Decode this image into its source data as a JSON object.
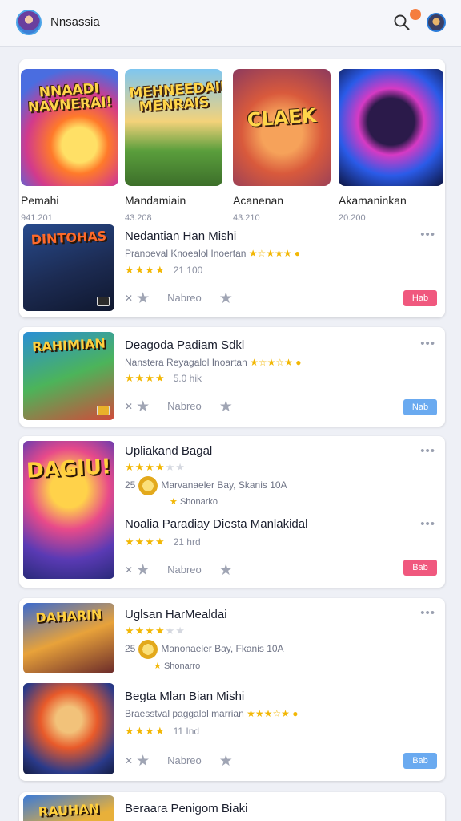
{
  "header": {
    "title": "Nnsassia"
  },
  "featured": [
    {
      "art_text": "NNAADI NAVNERAI!",
      "name": "Pemahi",
      "meta": "941.201"
    },
    {
      "art_text": "MEHNEEDAIN MENRAIS",
      "name": "Mandamiain",
      "meta": "43.208"
    },
    {
      "art_text": "CLAEK",
      "name": "Acanenan",
      "meta": "43.210"
    },
    {
      "art_text": "",
      "name": "Akamaninkan",
      "meta": "20.200"
    }
  ],
  "cards": {
    "c1": {
      "thumb_text": "DINTOHAS",
      "title": "Nedantian Han Mishi",
      "subtitle": "Pranoeval Knoealol Inoertan",
      "rating_count": "21 100",
      "action_label": "Nabreo",
      "button": "Hab"
    },
    "c2": {
      "thumb_text": "RAHIMIAN",
      "title": "Deagoda Padiam Sdkl",
      "subtitle": "Nanstera Reyagalol Inoartan",
      "rating_count": "5.0 hik",
      "action_label": "Nabreo",
      "button": "Nab"
    },
    "c3": {
      "thumb_text": "DAGIU!",
      "title": "Upliakand Bagal",
      "coin_prefix": "25",
      "coin_text": "Marvanaeler Bay, Skanis 10A",
      "coin_sub": "Shonarko",
      "title2": "Noalia Paradiay Diesta Manlakidal",
      "rating_count": "21 hrd",
      "action_label": "Nabreo",
      "button": "Bab"
    },
    "c4": {
      "thumb_text": "DAHARIN",
      "title": "Uglsan HarMealdai",
      "coin_prefix": "25",
      "coin_text": "Manonaeler Bay, Fkanis 10A",
      "coin_sub": "Shonarro",
      "title2": "Begta Mlan Bian Mishi",
      "subtitle2": "Braesstval paggalol marrian",
      "rating_count": "11 Ind",
      "action_label": "Nabreo",
      "button": "Bab"
    },
    "c5": {
      "thumb_text": "RAUHAN",
      "title": "Beraara Penigom Biaki"
    }
  }
}
